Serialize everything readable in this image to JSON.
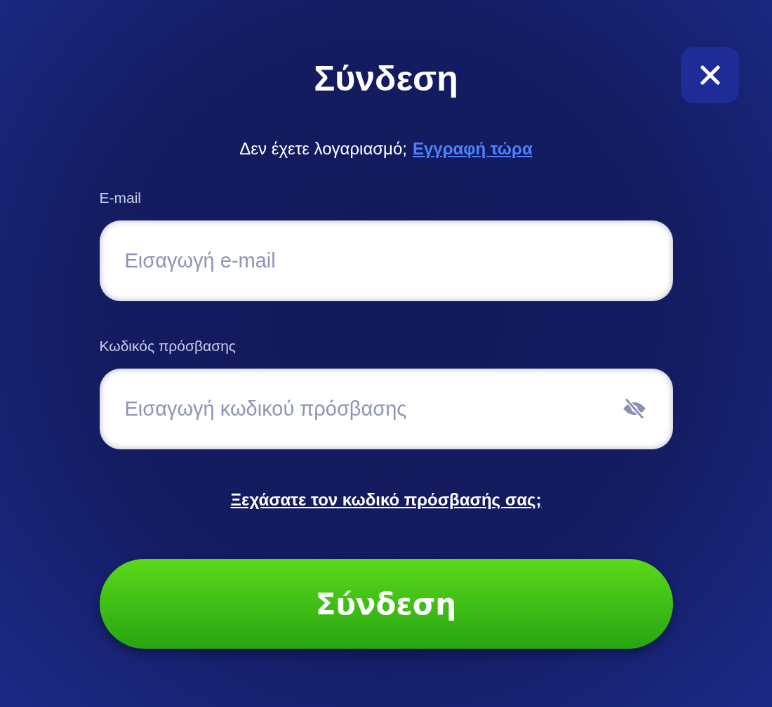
{
  "dialog": {
    "title": "Σύνδεση",
    "signup_prompt": {
      "text": "Δεν έχετε λογαριασμό;",
      "link": "Εγγραφή τώρα"
    },
    "fields": [
      {
        "kind": "email",
        "label": "E-mail",
        "placeholder": "Εισαγωγή e-mail"
      },
      {
        "kind": "password",
        "label": "Κωδικός πρόσβασης",
        "placeholder": "Εισαγωγή κωδικού πρόσβασης"
      }
    ],
    "forgot_link": "Ξεχάσατε τον κωδικό πρόσβασής σας;",
    "submit_button": "Σύνδεση"
  }
}
